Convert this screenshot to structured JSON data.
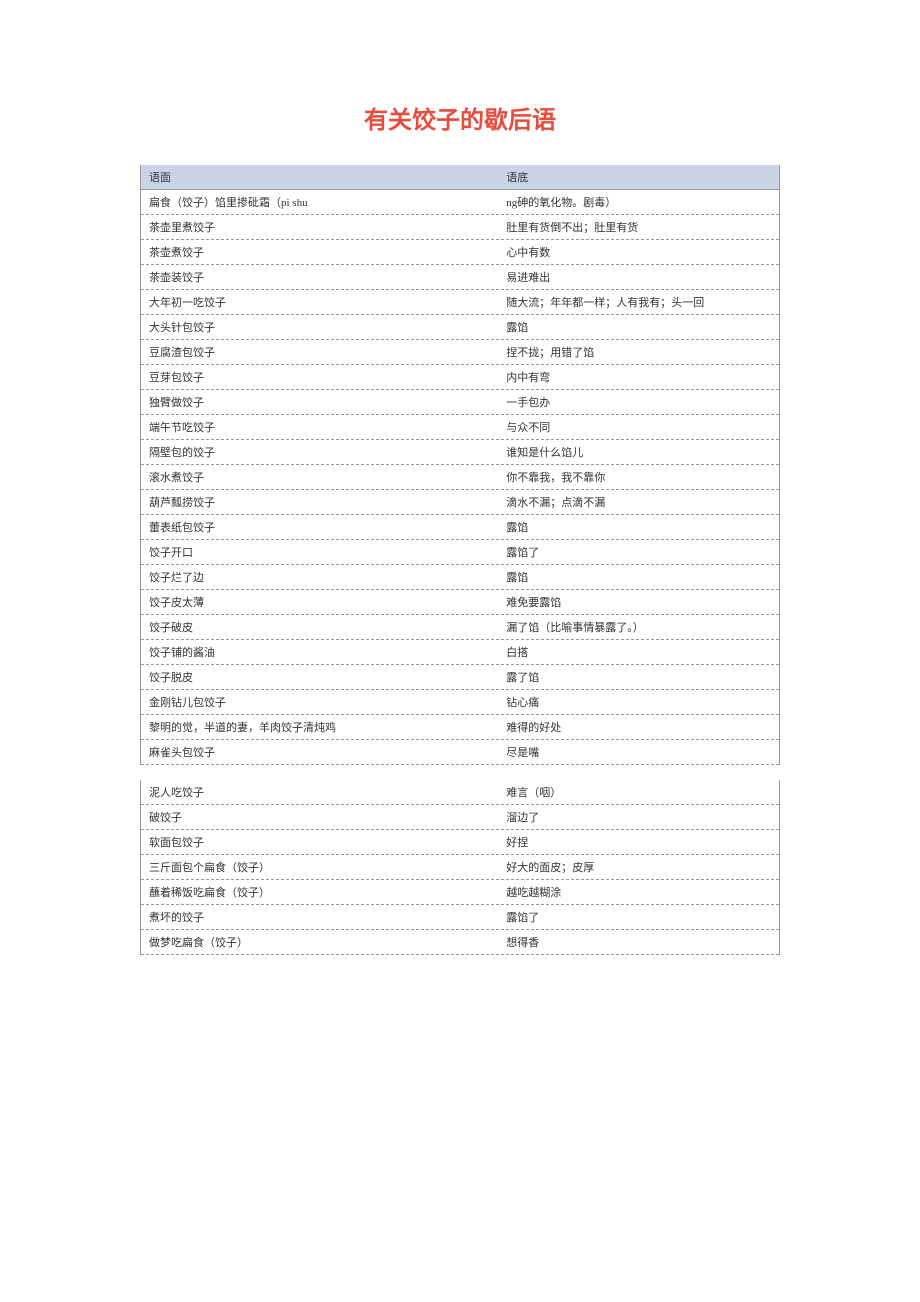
{
  "title": "有关饺子的歇后语",
  "table1": {
    "header": {
      "left": "语面",
      "right": "语底"
    },
    "rows": [
      {
        "left": "扁食（饺子）馅里掺砒霜（pi shu",
        "right": "ng砷的氧化物。剧毒）"
      },
      {
        "left": "茶壶里煮饺子",
        "right": "肚里有货倒不出；肚里有货"
      },
      {
        "left": "茶壶煮饺子",
        "right": "心中有数"
      },
      {
        "left": "茶壶装饺子",
        "right": "易进难出"
      },
      {
        "left": "大年初一吃饺子",
        "right": "随大流；年年都一样；人有我有；头一回"
      },
      {
        "left": "大头针包饺子",
        "right": "露馅"
      },
      {
        "left": "豆腐渣包饺子",
        "right": "捏不拢；用错了馅"
      },
      {
        "left": "豆芽包饺子",
        "right": "内中有弯"
      },
      {
        "left": "独臂做饺子",
        "right": "一手包办"
      },
      {
        "left": "端午节吃饺子",
        "right": "与众不同"
      },
      {
        "left": "隔壁包的饺子",
        "right": "谁知是什么馅儿"
      },
      {
        "left": "滚水煮饺子",
        "right": "你不靠我，我不靠你"
      },
      {
        "left": "葫芦瓢捞饺子",
        "right": "滴水不漏；点滴不漏"
      },
      {
        "left": "蕾表纸包饺子",
        "right": "露馅"
      },
      {
        "left": "饺子开口",
        "right": "露馅了"
      },
      {
        "left": "饺子烂了边",
        "right": "露馅"
      },
      {
        "left": "饺子皮太薄",
        "right": "难免要露馅"
      },
      {
        "left": "饺子破皮",
        "right": "漏了馅（比喻事情暴露了。）"
      },
      {
        "left": "饺子铺的酱油",
        "right": "白搭"
      },
      {
        "left": "饺子脱皮",
        "right": "露了馅"
      },
      {
        "left": "金刚钻儿包饺子",
        "right": "钻心痛"
      },
      {
        "left": "黎明的觉，半道的妻，羊肉饺子清炖鸡",
        "right": "难得的好处"
      },
      {
        "left": "麻雀头包饺子",
        "right": "尽是嘴"
      }
    ]
  },
  "table2": {
    "rows": [
      {
        "left": "泥人吃饺子",
        "right": "难言（咽）"
      },
      {
        "left": "破饺子",
        "right": "溜边了"
      },
      {
        "left": "软面包饺子",
        "right": "好捏"
      },
      {
        "left": "三斤面包个扁食（饺子）",
        "right": "好大的面皮；皮厚"
      },
      {
        "left": "蘸着稀饭吃扁食（饺子）",
        "right": "越吃越糊涂"
      },
      {
        "left": "煮坏的饺子",
        "right": "露馅了"
      },
      {
        "left": "做梦吃扁食（饺子）",
        "right": "想得香"
      }
    ]
  }
}
